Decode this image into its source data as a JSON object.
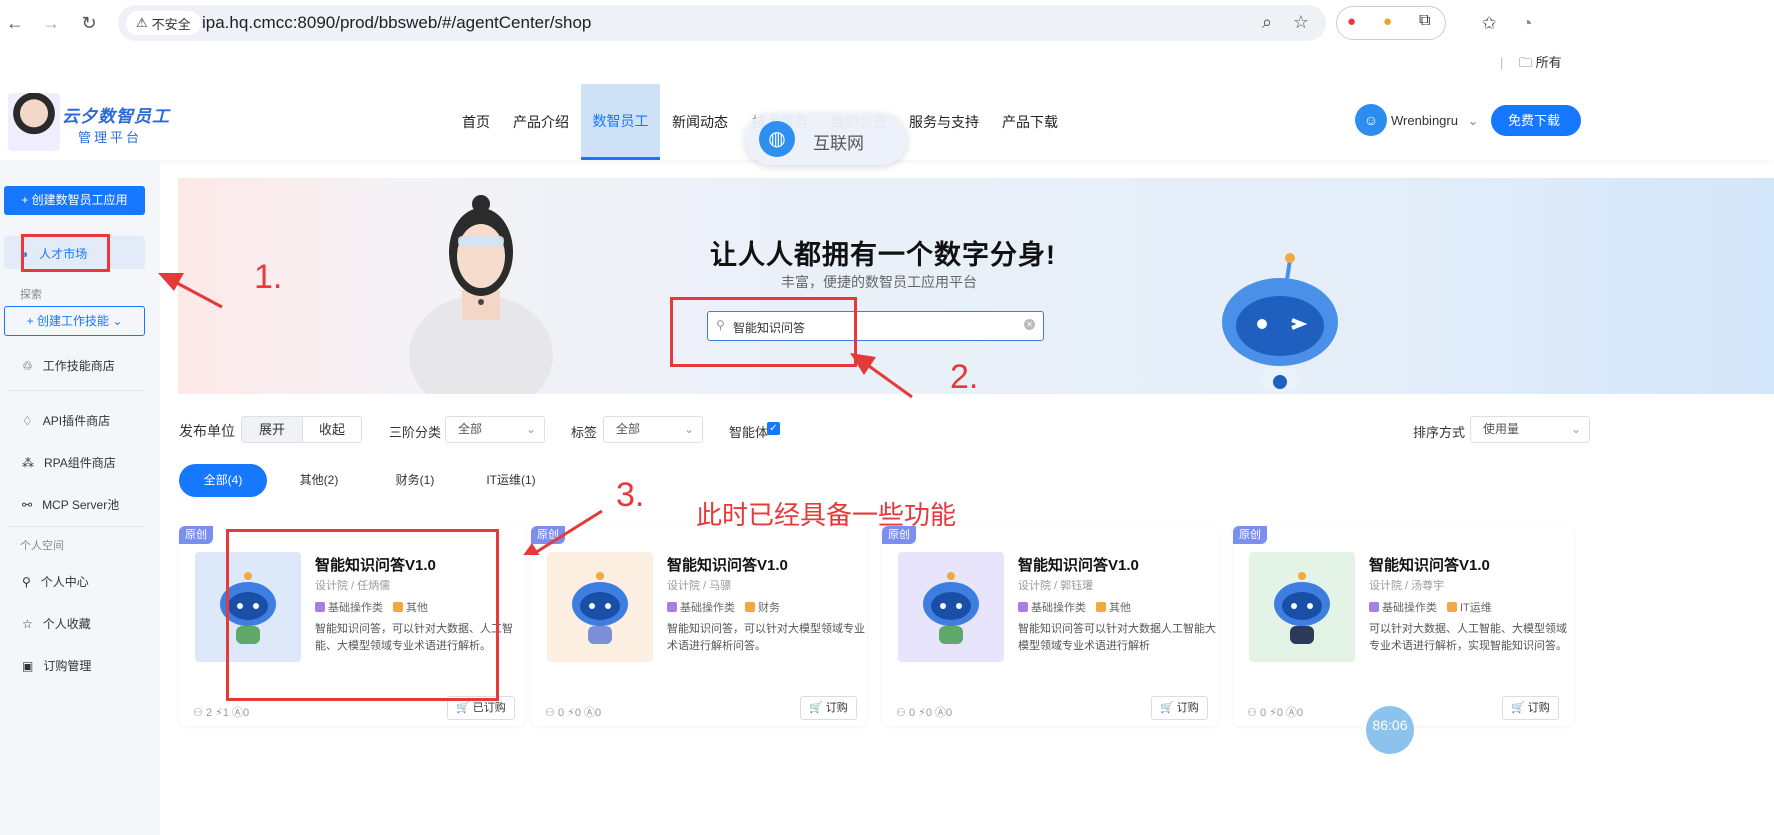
{
  "browser": {
    "not_secure": "不安全",
    "url": "ipa.hq.cmcc:8090/prod/bbsweb/#/agentCenter/shop",
    "bookmarks_label": "所有"
  },
  "header": {
    "logo_title": "云夕数智员工",
    "logo_subtitle": "管理平台",
    "nav": [
      {
        "label": "首页"
      },
      {
        "label": "产品介绍"
      },
      {
        "label": "数智员工"
      },
      {
        "label": "新闻动态"
      },
      {
        "label": "技术服务"
      },
      {
        "label": "维护公告"
      },
      {
        "label": "服务与支持"
      },
      {
        "label": "产品下载"
      }
    ],
    "user_name": "Wrenbingru",
    "download_label": "免费下载",
    "popup_label": "互联网"
  },
  "sidebar": {
    "create_button": "+ 创建数智员工应用",
    "active_item": "人才市场",
    "section_explore": "探索",
    "create_skill": "+ 创建工作技能",
    "items": [
      {
        "label": "工作技能商店"
      },
      {
        "label": "API插件商店"
      },
      {
        "label": "RPA组件商店"
      },
      {
        "label": "MCP Server池"
      }
    ],
    "section_personal": "个人空间",
    "personal_items": [
      {
        "label": "个人中心"
      },
      {
        "label": "个人收藏"
      },
      {
        "label": "订购管理"
      }
    ]
  },
  "banner": {
    "title": "让人人都拥有一个数字分身!",
    "subtitle": "丰富，便捷的数智员工应用平台",
    "search_value": "智能知识问答"
  },
  "filters": {
    "publisher_label": "发布单位",
    "expand": "展开",
    "collapse": "收起",
    "category_label": "三阶分类",
    "category_value": "全部",
    "tag_label": "标签",
    "tag_value": "全部",
    "agent_label": "智能体",
    "sort_label": "排序方式",
    "sort_value": "使用量"
  },
  "pills": [
    {
      "label": "全部(4)"
    },
    {
      "label": "其他(2)"
    },
    {
      "label": "财务(1)"
    },
    {
      "label": "IT运维(1)"
    }
  ],
  "annotations": {
    "one": "1.",
    "two": "2.",
    "three": "3.",
    "note": "此时已经具备一些功能"
  },
  "cards": [
    {
      "tag": "原创",
      "title": "智能知识问答V1.0",
      "author": "设计院 / 任炳儒",
      "type": "基础操作类",
      "category": "其他",
      "desc": "智能知识问答，可以针对大数据、人工智能、大模型领域专业术语进行解析。",
      "stats": "2  ⚡1  Ⓐ0",
      "button": "已订购"
    },
    {
      "tag": "原创",
      "title": "智能知识问答V1.0",
      "author": "设计院 / 马骠",
      "type": "基础操作类",
      "category": "财务",
      "desc": "智能知识问答，可以针对大模型领域专业术语进行解析问答。",
      "stats": "0  ⚡0  Ⓐ0",
      "button": "订购"
    },
    {
      "tag": "原创",
      "title": "智能知识问答V1.0",
      "author": "设计院 / 郭钰瓘",
      "type": "基础操作类",
      "category": "其他",
      "desc": "智能知识问答可以针对大数据人工智能大模型领域专业术语进行解析",
      "stats": "0  ⚡0  Ⓐ0",
      "button": "订购"
    },
    {
      "tag": "原创",
      "title": "智能知识问答V1.0",
      "author": "设计院 / 汤尊宇",
      "type": "基础操作类",
      "category": "IT运维",
      "desc": "可以针对大数据、人工智能、大模型领域专业术语进行解析，实现智能知识问答。",
      "stats": "0  ⚡0  Ⓐ0",
      "button": "订购"
    }
  ],
  "timer": "86:06"
}
